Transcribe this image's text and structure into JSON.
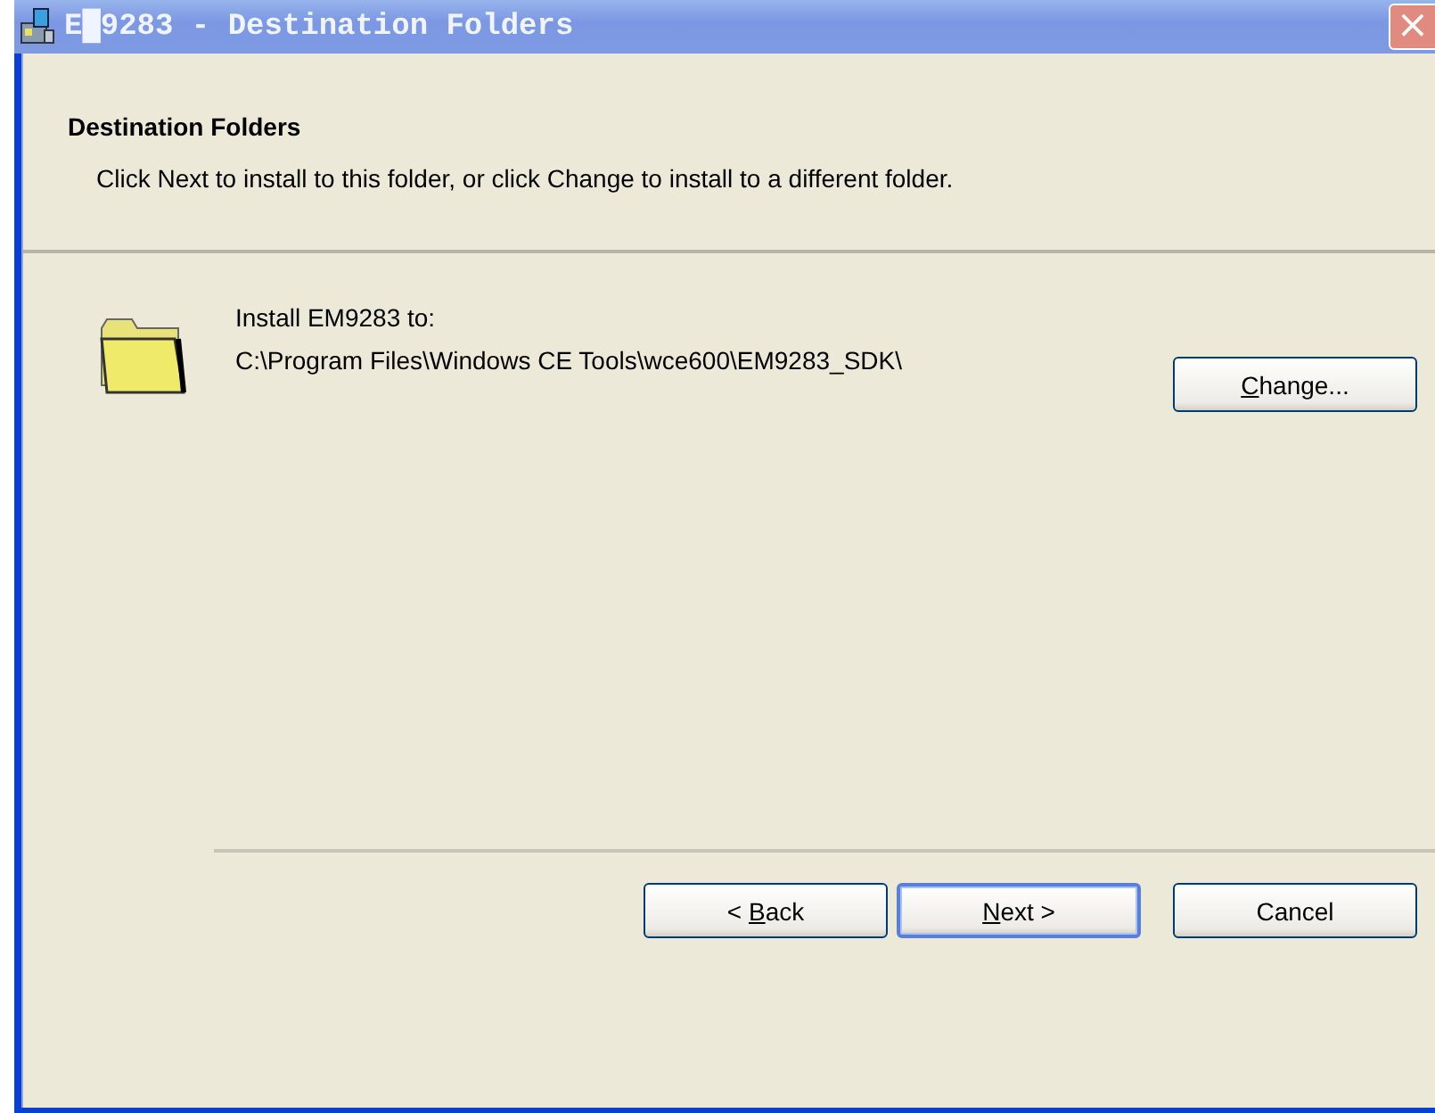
{
  "window": {
    "title": "E█9283 - Destination Folders",
    "close": "×"
  },
  "header": {
    "title": "Destination Folders",
    "description": "Click Next to install to this folder, or click Change to install to a different folder."
  },
  "destination": {
    "label": "Install EM9283 to:",
    "path": "C:\\Program Files\\Windows CE Tools\\wce600\\EM9283_SDK\\",
    "change_button": {
      "access_key": "C",
      "rest": "hange..."
    }
  },
  "buttons": [
    {
      "before": "< ",
      "access_key": "B",
      "rest": "ack",
      "default": false
    },
    {
      "access_key": "N",
      "rest": "ext >",
      "default": true
    },
    {
      "rest": "Cancel",
      "default": false
    }
  ]
}
